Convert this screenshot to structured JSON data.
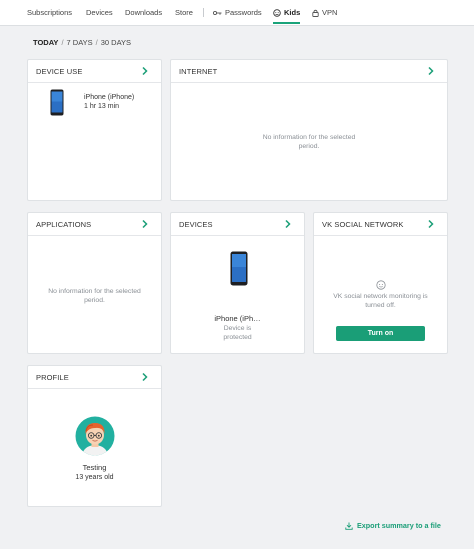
{
  "nav": {
    "items": [
      {
        "label": "Subscriptions"
      },
      {
        "label": "Devices"
      },
      {
        "label": "Downloads"
      },
      {
        "label": "Store"
      },
      {
        "label": "Passwords"
      },
      {
        "label": "Kids"
      },
      {
        "label": "VPN"
      }
    ],
    "active": "Kids"
  },
  "range": {
    "options": [
      "TODAY",
      "7 DAYS",
      "30 DAYS"
    ],
    "selected": "TODAY"
  },
  "device_use": {
    "title": "DEVICE USE",
    "device_name": "iPhone (iPhone)",
    "usage": "1 hr 13 min"
  },
  "internet": {
    "title": "INTERNET",
    "empty_line1": "No information for the selected",
    "empty_line2": "period."
  },
  "applications": {
    "title": "APPLICATIONS",
    "empty_line1": "No information for the selected",
    "empty_line2": "period."
  },
  "devices": {
    "title": "DEVICES",
    "device_name": "iPhone (iPh…",
    "status_line1": "Device is",
    "status_line2": "protected"
  },
  "vk": {
    "title": "VK SOCIAL NETWORK",
    "msg_line1": "VK social network monitoring is",
    "msg_line2": "turned off.",
    "button_label": "Turn on"
  },
  "profile": {
    "title": "PROFILE",
    "name": "Testing",
    "age": "13 years old"
  },
  "export_label": "Export summary to a file",
  "colors": {
    "accent": "#1a9e77",
    "avatar_bg": "#22b0a0",
    "hair": "#e8622e"
  }
}
